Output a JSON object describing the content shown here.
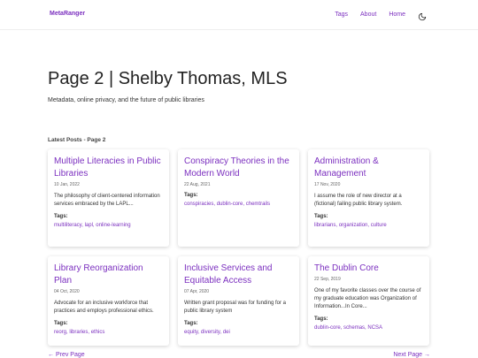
{
  "header": {
    "brand_icon": "",
    "brand": "MetaRanger",
    "nav": [
      "Tags",
      "About",
      "Home"
    ],
    "theme_icon": "moon-icon"
  },
  "page": {
    "title": "Page 2 | Shelby Thomas, MLS",
    "subtitle": "Metadata, online privacy, and the future of public libraries",
    "section_label": "Latest Posts - Page 2"
  },
  "posts": [
    {
      "title": "Multiple Literacies in Public Libraries",
      "date": "10 Jan, 2022",
      "desc": "The philosophy of client-centered information services embraced by the LAPL...",
      "tags_label": "Tags:",
      "tags": [
        "multiliteracy",
        "lapl",
        "online-learning"
      ]
    },
    {
      "title": "Conspiracy Theories in the Modern World",
      "date": "22 Aug, 2021",
      "desc": "",
      "tags_label": "Tags:",
      "tags": [
        "conspiracies",
        "dublin-core",
        "chemtrails"
      ]
    },
    {
      "title": "Administration & Management",
      "date": "17 Nov, 2020",
      "desc": "I assume the role of new director at a (fictional) failing public library system.",
      "tags_label": "Tags:",
      "tags": [
        "librarians",
        "organization",
        "culture"
      ]
    },
    {
      "title": "Library Reorganization Plan",
      "date": "04 Oct, 2020",
      "desc": "Advocate for an inclusive workforce that practices and employs professional ethics.",
      "tags_label": "Tags:",
      "tags": [
        "reorg",
        "libraries",
        "ethics"
      ]
    },
    {
      "title": "Inclusive Services and Equitable Access",
      "date": "07 Apr, 2020",
      "desc": "Written grant proposal was for funding for a public library system",
      "tags_label": "Tags:",
      "tags": [
        "equity",
        "diversity",
        "dei"
      ]
    },
    {
      "title": "The Dublin Core",
      "date": "22 Sep, 2019",
      "desc": "One of my favorite classes over the course of my graduate education was Organization of Information...In Core...",
      "tags_label": "Tags:",
      "tags": [
        "dublin-core",
        "schemas",
        "NCSA"
      ]
    }
  ],
  "pagination": {
    "prev": "← Prev Page",
    "next": "Next Page →"
  },
  "colors": {
    "accent": "#7b2fbf"
  }
}
